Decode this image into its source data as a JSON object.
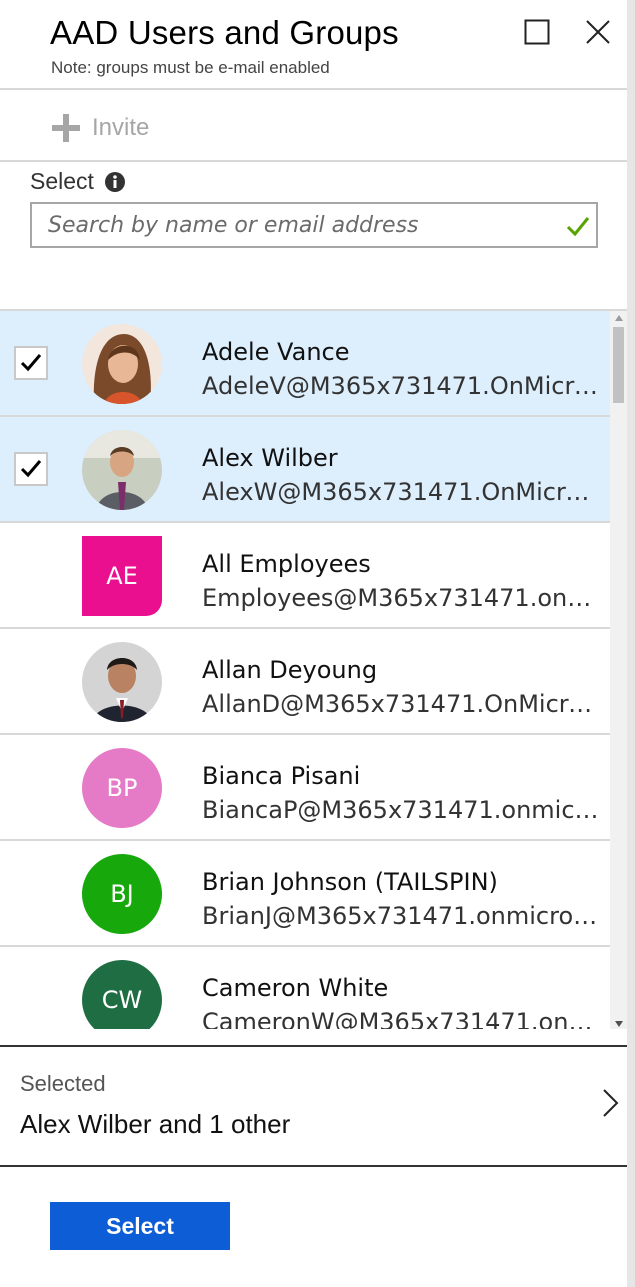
{
  "header": {
    "title": "AAD Users and Groups",
    "subtitle": "Note: groups must be e-mail enabled"
  },
  "toolbar": {
    "invite_label": "Invite"
  },
  "select": {
    "label": "Select",
    "search_placeholder": "Search by name or email address",
    "search_value": ""
  },
  "list": {
    "items": [
      {
        "name": "Adele Vance",
        "email": "AdeleV@M365x731471.OnMicro...",
        "selected": true,
        "avatar_type": "photo"
      },
      {
        "name": "Alex Wilber",
        "email": "AlexW@M365x731471.OnMicros...",
        "selected": true,
        "avatar_type": "photo"
      },
      {
        "name": "All Employees",
        "email": "Employees@M365x731471.onmi...",
        "selected": false,
        "avatar_type": "group",
        "initials": "AE",
        "color": "#ea0f8f"
      },
      {
        "name": "Allan Deyoung",
        "email": "AllanD@M365x731471.OnMicros...",
        "selected": false,
        "avatar_type": "photo"
      },
      {
        "name": "Bianca Pisani",
        "email": "BiancaP@M365x731471.onmicro...",
        "selected": false,
        "avatar_type": "initials",
        "initials": "BP",
        "color": "#e57ac7"
      },
      {
        "name": "Brian Johnson (TAILSPIN)",
        "email": "BrianJ@M365x731471.onmicroso...",
        "selected": false,
        "avatar_type": "initials",
        "initials": "BJ",
        "color": "#17a80c"
      },
      {
        "name": "Cameron White",
        "email": "CameronW@M365x731471.onmi...",
        "selected": false,
        "avatar_type": "initials",
        "initials": "CW",
        "color": "#1f6e43"
      }
    ]
  },
  "summary": {
    "label": "Selected",
    "value": "Alex Wilber and 1 other"
  },
  "footer": {
    "select_label": "Select"
  },
  "colors": {
    "selected_row": "#ddeefd",
    "primary_button": "#0d5dd6",
    "valid_check": "#57a300"
  }
}
